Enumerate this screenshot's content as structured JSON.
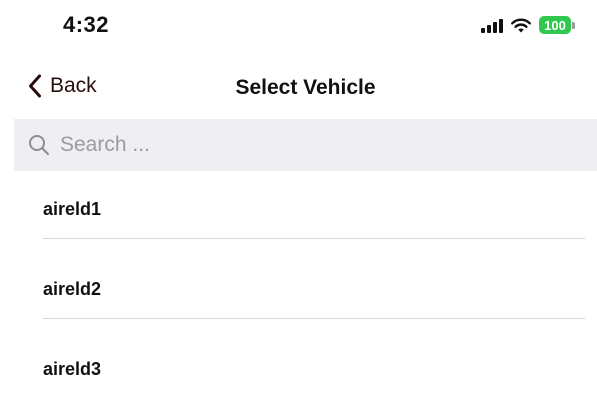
{
  "status_bar": {
    "time": "4:32",
    "battery": "100",
    "icons": [
      "signal-icon",
      "wifi-icon",
      "battery-icon"
    ]
  },
  "nav": {
    "back_label": "Back",
    "title": "Select Vehicle",
    "back_icon": "chevron-left-icon"
  },
  "search": {
    "placeholder": "Search ...",
    "value": "",
    "icon": "search-icon"
  },
  "vehicles": [
    {
      "label": "aireld1"
    },
    {
      "label": "aireld2"
    },
    {
      "label": "aireld3"
    }
  ],
  "colors": {
    "battery_green": "#30c94f",
    "search_bg": "#efeff2",
    "divider": "#d7d7d9"
  }
}
